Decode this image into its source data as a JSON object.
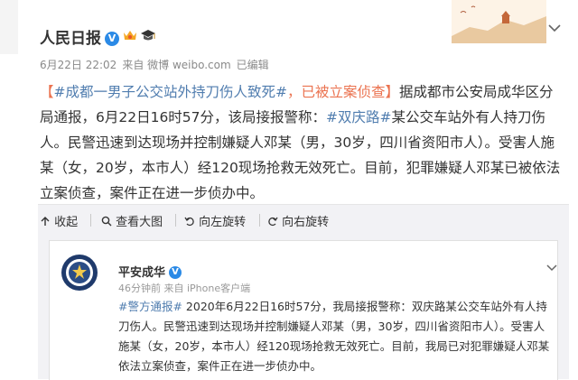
{
  "header": {
    "account_name": "人民日报",
    "verified_badge": "V",
    "time": "6月22日 22:02",
    "source": "来自 微博 weibo.com",
    "edited": "已编辑",
    "icons": [
      "avatar-image",
      "crown-badge-icon",
      "graduation-cap-icon",
      "great-wall-banner",
      "chevron-down-icon"
    ]
  },
  "post": {
    "bracket_open": "【",
    "hashtag": "#成都一男子公交站外持刀伤人致死#",
    "title_rest": "，已被立案侦查】",
    "body_before_link": "据成都市公安局成华区分局通报，6月22日16时57分，该局接报警称：",
    "road_tag": "#双庆路#",
    "body_after_link": "某公交车站外有人持刀伤人。民警迅速到达现场并控制嫌疑人邓某（男，30岁，四川省资阳市人）。受害人施某（女，20岁，本市人）经120现场抢救无效死亡。目前，犯罪嫌疑人邓某已被依法立案侦查，案件正在进一步侦办中。"
  },
  "toolbar": {
    "collapse_label": "收起",
    "view_large_label": "查看大图",
    "rotate_left_label": "向左旋转",
    "rotate_right_label": "向右旋转",
    "icons": [
      "collapse-arrow-icon",
      "magnifier-icon",
      "rotate-left-icon",
      "rotate-right-icon"
    ]
  },
  "repost": {
    "account_name": "平安成华",
    "verified_badge": "V",
    "meta": "46分钟前 来自 iPhone客户端",
    "tag": "#警方通报#",
    "text": " 2020年6月22日16时57分，我局接报警称：双庆路某公交车站外有人持刀伤人。民警迅速到达现场并控制嫌疑人邓某（男，30岁，四川省资阳市人）。受害人施某（女，20岁，本市人）经120现场抢救无效死亡。目前，我局已对犯罪嫌疑人邓某依法立案侦查，案件正在进一步侦办中。"
  },
  "colors": {
    "hashtag": "#eb7350",
    "link": "#507daf",
    "verified": "#2b8ae6",
    "meta_gray": "#8a8a8a",
    "toolbar_bg": "#f2f2f5"
  }
}
